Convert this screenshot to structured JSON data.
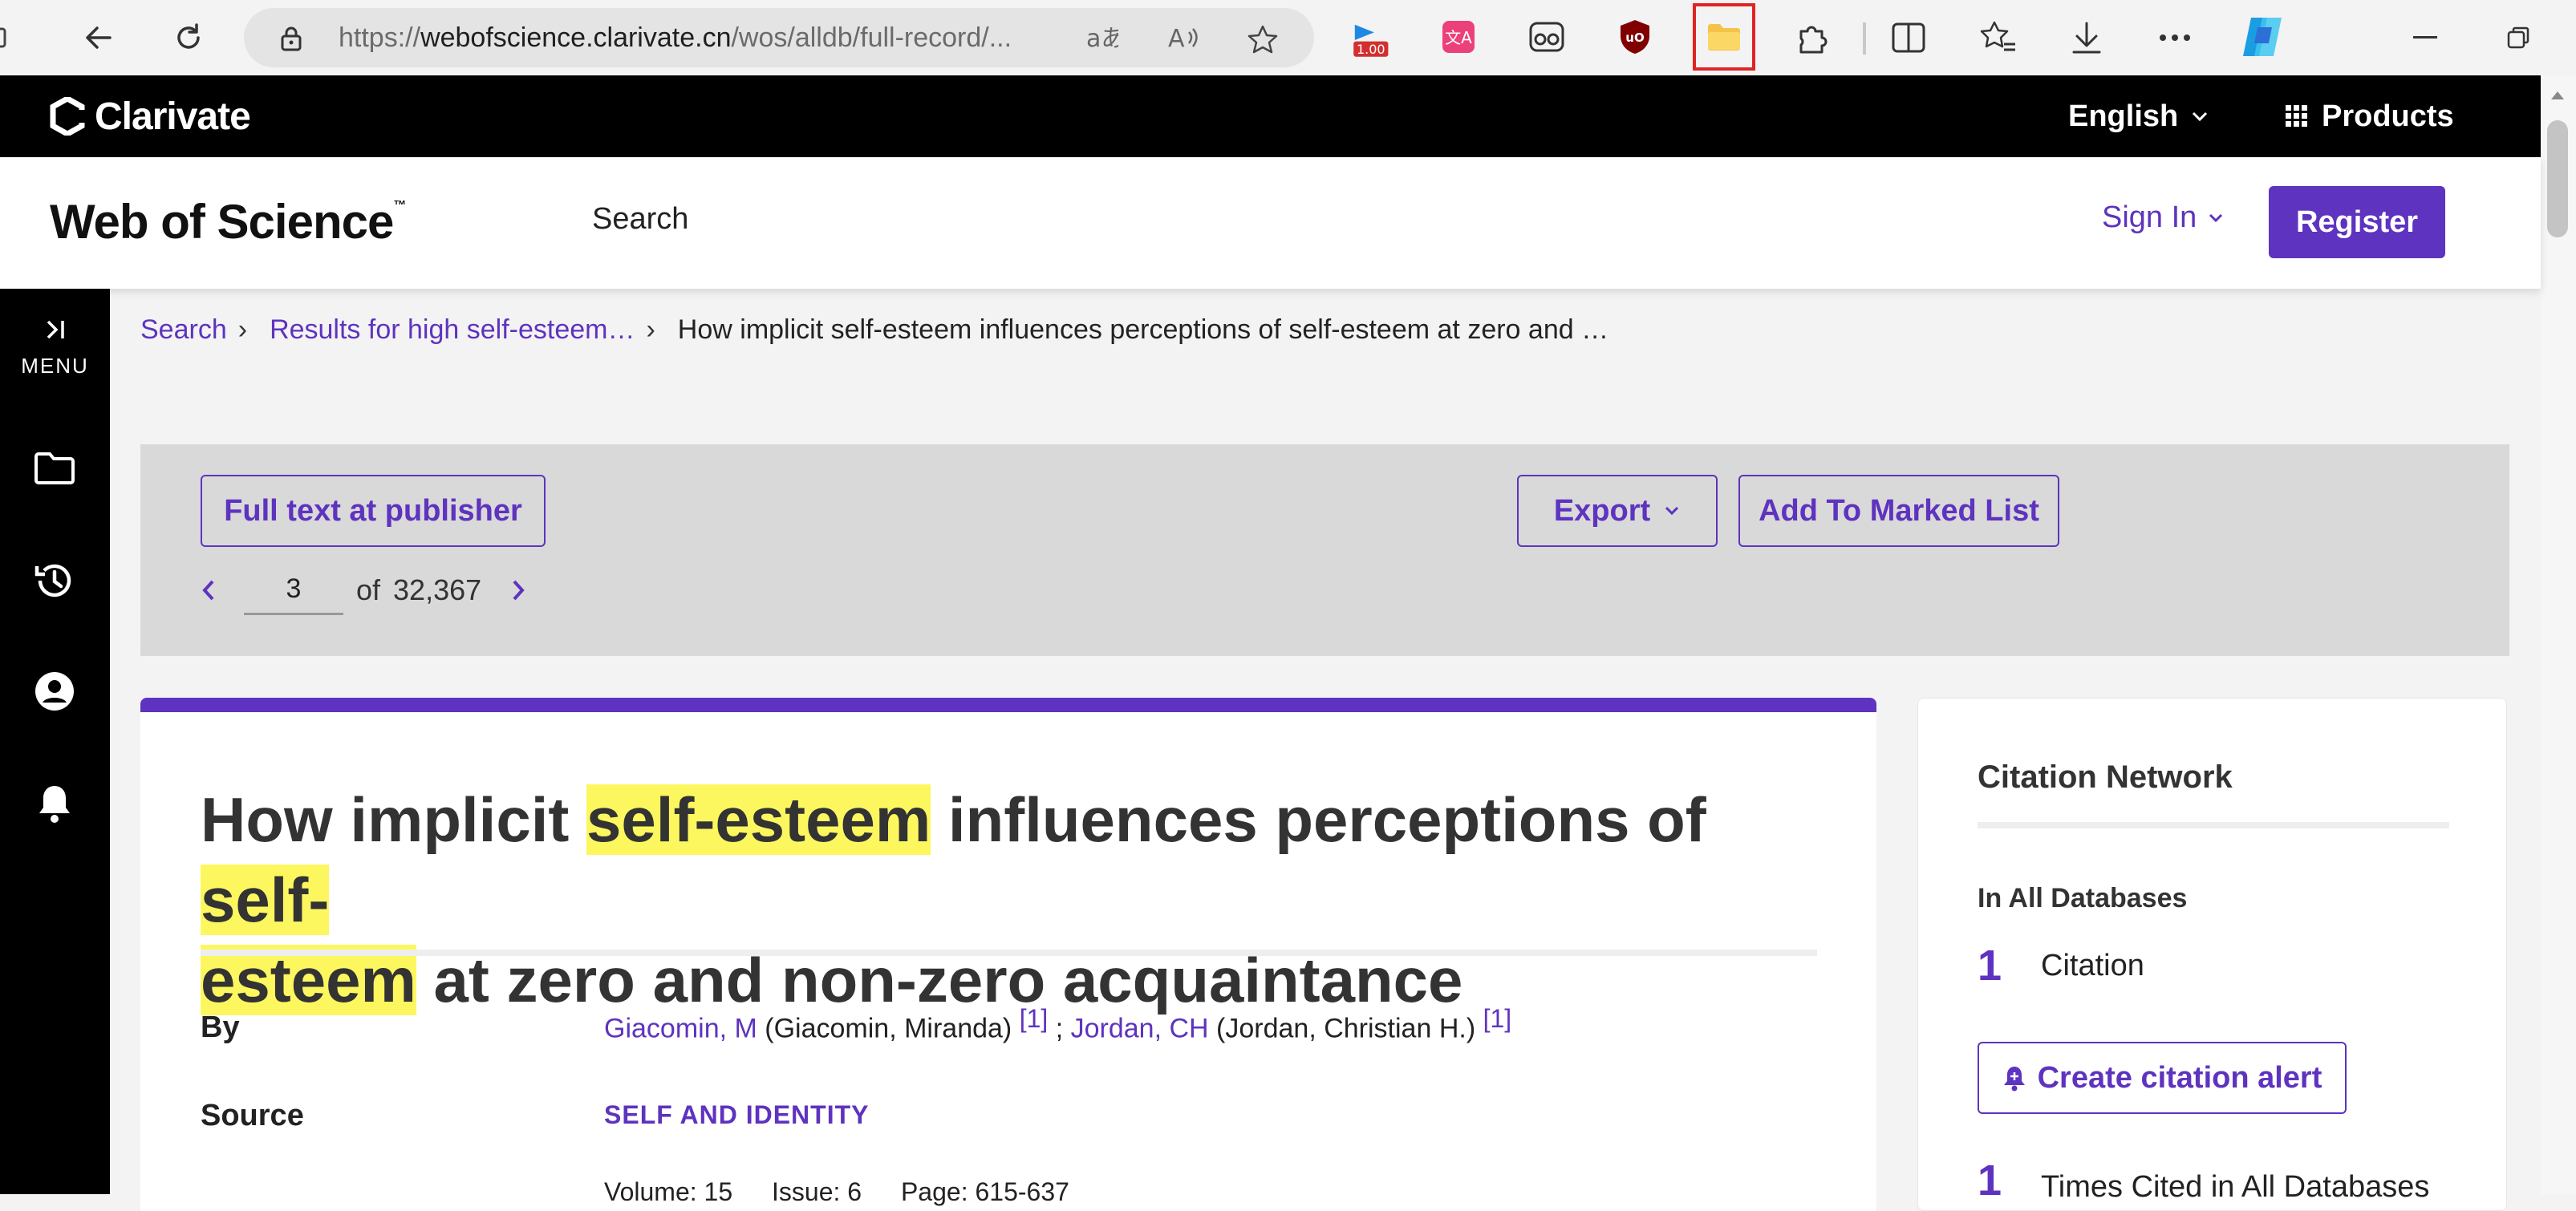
{
  "browser": {
    "url_prefix": "https://",
    "url_host": "webofscience.clarivate.cn",
    "url_path": "/wos/alldb/full-record/...",
    "ext_badge": "1.00"
  },
  "clarivate": {
    "logo": "Clarivate",
    "language": "English",
    "products": "Products"
  },
  "wos": {
    "logo": "Web of Science",
    "trademark": "™",
    "search": "Search",
    "sign_in": "Sign In",
    "register": "Register"
  },
  "left_nav": {
    "menu_label": "MENU"
  },
  "breadcrumb": {
    "search": "Search",
    "results": "Results for high self-esteem…",
    "current": "How implicit self-esteem influences perceptions of self-esteem at zero and …"
  },
  "actions": {
    "full_text": "Full text at publisher",
    "export": "Export",
    "add_marked": "Add To Marked List",
    "page_value": "3",
    "of": "of",
    "total": "32,367"
  },
  "record": {
    "title_1": "How implicit ",
    "title_hl_1": "self-esteem",
    "title_2": " influences perceptions of ",
    "title_hl_2a": "self-",
    "title_hl_2b": "esteem",
    "title_3": " at zero and non-zero acquaintance",
    "by_label": "By",
    "author1_link": "Giacomin, M",
    "author1_full": " (Giacomin, Miranda) ",
    "author1_ref": "[1]",
    "author_sep": " ; ",
    "author2_link": "Jordan, CH",
    "author2_full": " (Jordan, Christian H.) ",
    "author2_ref": "[1]",
    "source_label": "Source",
    "source_title": "SELF AND IDENTITY",
    "volume": "Volume: 15",
    "issue": "Issue: 6",
    "page": "Page: 615-637"
  },
  "citation": {
    "heading": "Citation Network",
    "db_label": "In All Databases",
    "count": "1",
    "count_label": "Citation",
    "alert_button": "Create citation alert",
    "times_count": "1",
    "times_label": "Times Cited in All Databases"
  }
}
